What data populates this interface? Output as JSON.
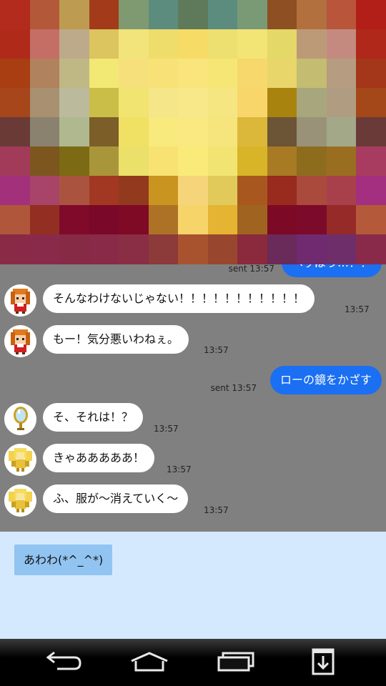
{
  "messages": [
    {
      "side": "out",
      "text": "ヘッぽう…！！",
      "sent_label": "sent 13:57"
    },
    {
      "side": "in",
      "avatar": "girl-avatar-icon",
      "text": "そんなわけないじゃない！！！！！！！！！！！",
      "time": "13:57"
    },
    {
      "side": "in",
      "avatar": "girl-avatar-icon",
      "text": "もー！気分悪いわねぇ。",
      "time": "13:57"
    },
    {
      "side": "out",
      "text": "ローの鏡をかざす",
      "sent_label": "sent 13:57"
    },
    {
      "side": "in",
      "avatar": "mirror-avatar-icon",
      "text": "そ、それは！？",
      "time": "13:57"
    },
    {
      "side": "in",
      "avatar": "fairy-avatar-icon",
      "text": "きゃあああああ！",
      "time": "13:57"
    },
    {
      "side": "in",
      "avatar": "fairy-avatar-icon",
      "text": "ふ、服が〜消えていく〜",
      "time": "13:57"
    }
  ],
  "quick_reply": {
    "label": "あわわ(*^_^*)"
  },
  "navbar": {
    "back": "back-arrow-icon",
    "home": "home-icon",
    "recents": "recent-apps-icon",
    "download": "download-icon"
  },
  "colors": {
    "chat_bg": "#808080",
    "bubble_out": "#1a6ff2",
    "bubble_in": "#ffffff",
    "input_bg": "#d4e9fe",
    "quick_reply_bg": "#91c4f1"
  },
  "mosaic": {
    "cols": 13,
    "rows": 9,
    "colors": [
      [
        "#b22b1c",
        "#b4583a",
        "#bd9c51",
        "#a33a1a",
        "#7f9a70",
        "#5c8c7e",
        "#5e7a5a",
        "#5c8c7e",
        "#7a9a76",
        "#8e4f22",
        "#b2703e",
        "#b8553a",
        "#b21f18"
      ],
      [
        "#b02a1a",
        "#c46e66",
        "#bcaa8a",
        "#dcc45e",
        "#f2e47a",
        "#eedd6a",
        "#f6dc66",
        "#eee070",
        "#f3e476",
        "#e4d868",
        "#bc9a78",
        "#c48a80",
        "#b0281a"
      ],
      [
        "#a83e12",
        "#b0825e",
        "#c0b884",
        "#f2e874",
        "#f6e07c",
        "#f8e278",
        "#fae47c",
        "#f6e676",
        "#f6d86c",
        "#e8d66a",
        "#c4bc70",
        "#b69c80",
        "#a4361a"
      ],
      [
        "#a6461a",
        "#a89070",
        "#bcba9c",
        "#cabe48",
        "#f2e470",
        "#f6e68a",
        "#f8e88a",
        "#f6e682",
        "#f8d66a",
        "#a8840e",
        "#a8a67c",
        "#b09c80",
        "#a4481a"
      ],
      [
        "#6a3a36",
        "#8a826e",
        "#b0b890",
        "#7c5e28",
        "#f0e064",
        "#f8ea7c",
        "#fae880",
        "#f6e47c",
        "#dcb83a",
        "#6c5436",
        "#9a9278",
        "#a2a888",
        "#6a3a38"
      ],
      [
        "#a23a5a",
        "#7c561e",
        "#7c6a14",
        "#aa963a",
        "#eae06a",
        "#f8e272",
        "#faea7a",
        "#f2e472",
        "#d8b428",
        "#a87a24",
        "#8e6c1e",
        "#9a6e20",
        "#a83c60"
      ],
      [
        "#a2307a",
        "#a84468",
        "#aa5440",
        "#a23822",
        "#923a1e",
        "#c99420",
        "#f6d47a",
        "#e2ca5a",
        "#a8581e",
        "#982a1e",
        "#aa4a3c",
        "#a8404c",
        "#a42e80"
      ],
      [
        "#b0563a",
        "#922e22",
        "#800a2a",
        "#7a0828",
        "#7e0a26",
        "#ae7226",
        "#f6d46a",
        "#e4b432",
        "#a06420",
        "#7c0a26",
        "#7c0a2a",
        "#962a28",
        "#b45a3a"
      ],
      [
        "#8a2a46",
        "#8a2a4a",
        "#862a46",
        "#882a48",
        "#8a2e46",
        "#8c3a3a",
        "#a8522e",
        "#98462e",
        "#8a2a3c",
        "#6a2a5a",
        "#702a70",
        "#6e2e6a",
        "#8a2a4a"
      ]
    ]
  }
}
